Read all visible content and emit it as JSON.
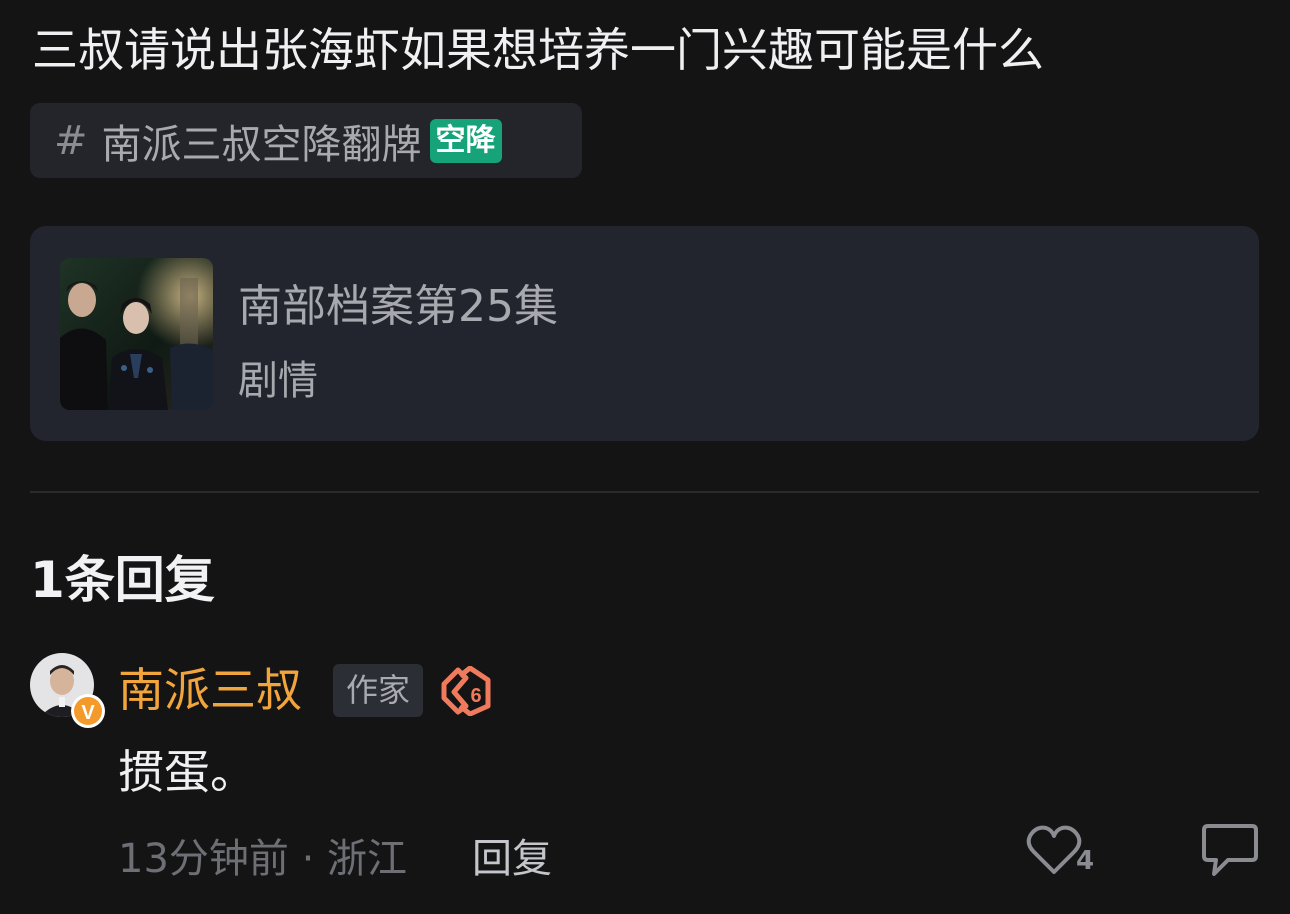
{
  "question": "三叔请说出张海虾如果想培养一门兴趣可能是什么",
  "topic": {
    "hash": "#",
    "text": "南派三叔空降翻牌",
    "badge": "空降"
  },
  "card": {
    "title": "南部档案第25集",
    "subtitle": "剧情"
  },
  "replies_header": "1条回复",
  "reply": {
    "author": "南派三叔",
    "verified_badge": "V",
    "role": "作家",
    "text": "掼蛋。",
    "meta": "13分钟前 · 浙江",
    "reply_label": "回复",
    "likes": "4"
  },
  "colors": {
    "background": "#141415",
    "author_name": "#f1a53c",
    "topic_badge": "#16a37a",
    "verified": "#f39a2b",
    "level_icon": "#ef7a5c"
  }
}
